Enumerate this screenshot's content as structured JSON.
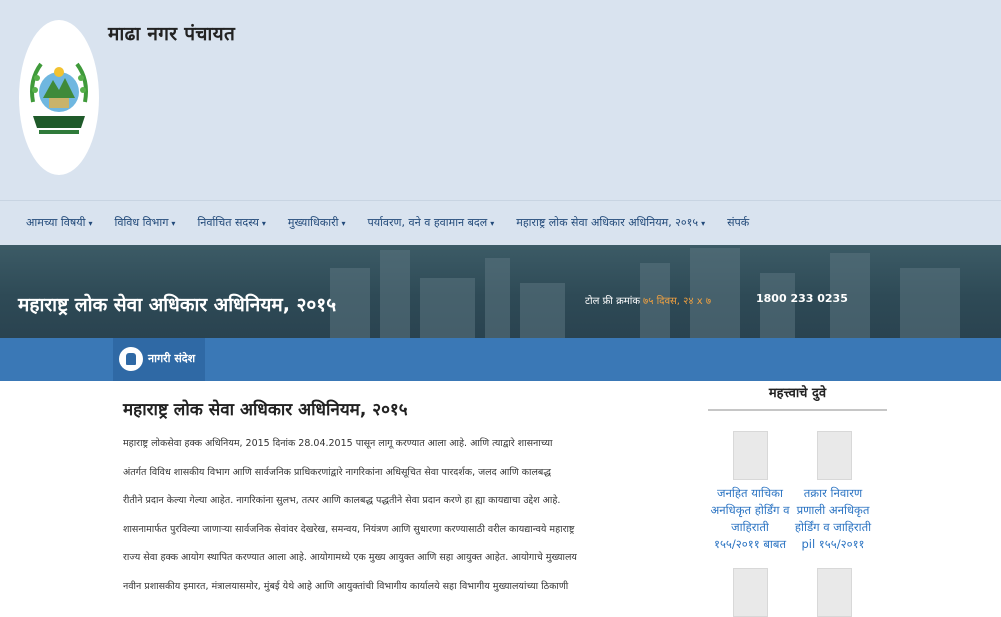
{
  "site": {
    "title": "माढा नगर पंचायत"
  },
  "nav": {
    "items": [
      {
        "label": "आमच्या विषयी",
        "caret": "▾"
      },
      {
        "label": "विविध विभाग",
        "caret": "▾"
      },
      {
        "label": "निर्वाचित सदस्य",
        "caret": "▾"
      },
      {
        "label": "मुख्याधिकारी",
        "caret": "▾"
      },
      {
        "label": "पर्यावरण, वने व हवामान बदल",
        "caret": "▾"
      },
      {
        "label": "महाराष्ट्र लोक सेवा अधिकार अधिनियम, २०१५",
        "caret": "▾"
      },
      {
        "label": "संपर्क",
        "caret": ""
      }
    ]
  },
  "banner": {
    "title": "महाराष्ट्र लोक सेवा अधिकार अधिनियम, २०१५",
    "tollfree_label": "टोल फ्री क्रमांक",
    "tollfree_days": "७५ दिवस, २४ x ७",
    "tollfree_number": "1800 233 0235"
  },
  "news_tab": {
    "label": "नागरी संदेश",
    "icon": "megaphone-icon"
  },
  "article": {
    "heading": "महाराष्ट्र लोक सेवा अधिकार अधिनियम, २०१५",
    "lines": [
      " महाराष्ट्र लोकसेवा हक्क अधिनियम, 2015 दिनांक 28.04.2015 पासून लागू करण्यात आला आहे. आणि त्याद्वारे शासनाच्या",
      "अंतर्गत विविध शासकीय विभाग आणि सार्वजनिक प्राधिकरणांद्वारे नागरिकांना अधिसूचित सेवा पारदर्शक, जलद आणि कालबद्ध",
      "रीतीने प्रदान केल्या गेल्या आहेत. नागरिकांना सुलभ, तत्पर आणि कालबद्ध पद्धतीने सेवा प्रदान करणे हा ह्या कायद्याचा उद्देश आहे.",
      "शासनामार्फत पुरविल्या जाणाऱ्या सार्वजनिक सेवांवर देखरेख, समन्वय, नियंत्रण आणि सुधारणा करण्यासाठी वरील कायद्यान्वये महाराष्ट्र",
      "राज्य सेवा हक्क आयोग स्थापित करण्यात आला आहे. आयोगामध्ये एक मुख्य आयुक्त आणि सहा आयुक्त आहेत. आयोगाचे मुख्यालय",
      "नवीन प्रशासकीय इमारत, मंत्रालयासमोर, मुंबई येथे आहे आणि आयुक्तांची विभागीय कार्यालये सहा विभागीय मुख्यालयांच्या ठिकाणी"
    ]
  },
  "sidebar": {
    "title": "महत्त्वाचे दुवे",
    "documents": [
      {
        "title": "जनहित याचिका अनधिकृत होर्डिंग व जाहिराती १५५/२०११ बाबत"
      },
      {
        "title": "तक्रार निवारण प्रणाली अनधिकृत होर्डिंग व जाहिराती pil १५५/२०११"
      },
      {
        "title": ""
      },
      {
        "title": ""
      }
    ]
  },
  "colors": {
    "header_bg": "#d9e3ef",
    "nav_text": "#224a7a",
    "bluebar": "#3a78b6",
    "link": "#2a73c2",
    "accent_orange": "#f0a040"
  }
}
